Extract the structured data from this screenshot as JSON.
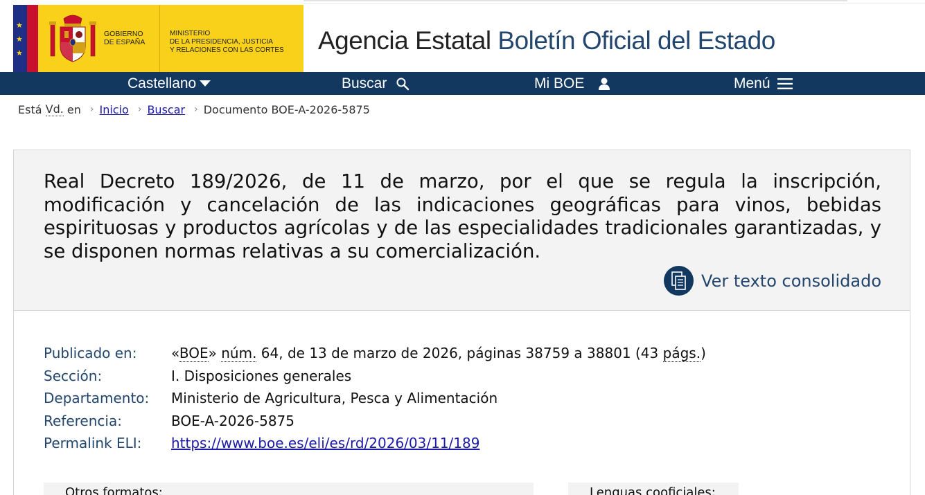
{
  "header": {
    "gobierno_line1": "GOBIERNO",
    "gobierno_line2": "DE ESPAÑA",
    "ministerio_line1": "MINISTERIO",
    "ministerio_line2": "DE LA PRESIDENCIA, JUSTICIA",
    "ministerio_line3": "Y RELACIONES CON LAS CORTES",
    "site_title_part1": "Agencia Estatal",
    "site_title_part2": "Boletín Oficial del Estado"
  },
  "nav": {
    "language": "Castellano",
    "search": "Buscar",
    "my_boe": "Mi BOE",
    "menu": "Menú"
  },
  "breadcrumb": {
    "prefix1": "Está",
    "prefix_abbr": "Vd.",
    "prefix2": "en",
    "items": [
      "Inicio",
      "Buscar"
    ],
    "current": "Documento BOE-A-2026-5875"
  },
  "document": {
    "title": "Real Decreto 189/2026, de 11 de marzo, por el que se regula la inscripción, modificación y cancelación de las indicaciones geográficas para vinos, bebidas espirituosas y productos agrícolas y de las especialidades tradicionales garantizadas, y se disponen normas relativas a su comercialización.",
    "consolidated_link": "Ver texto consolidado",
    "metadata": {
      "published_key": "Publicado en:",
      "published_open": "«",
      "published_boe": "BOE",
      "published_close": "»",
      "published_num": "núm.",
      "published_rest": " 64, de 13 de marzo de 2026, páginas 38759 a 38801 (43 ",
      "published_pags": "págs.",
      "published_end": ")",
      "section_key": "Sección:",
      "section_val": "I. Disposiciones generales",
      "department_key": "Departamento:",
      "department_val": "Ministerio de Agricultura, Pesca y Alimentación",
      "reference_key": "Referencia:",
      "reference_val": "BOE-A-2026-5875",
      "permalink_key": "Permalink ELI:",
      "permalink_val": "https://www.boe.es/eli/es/rd/2026/03/11/189"
    },
    "other_formats": "Otros formatos:",
    "co_official_languages": "Lenguas cooficiales:"
  },
  "colors": {
    "nav_bg": "#13385f",
    "accent_text": "#23466e",
    "logo_yellow": "#f9d11a",
    "link": "#1a1aa6"
  }
}
